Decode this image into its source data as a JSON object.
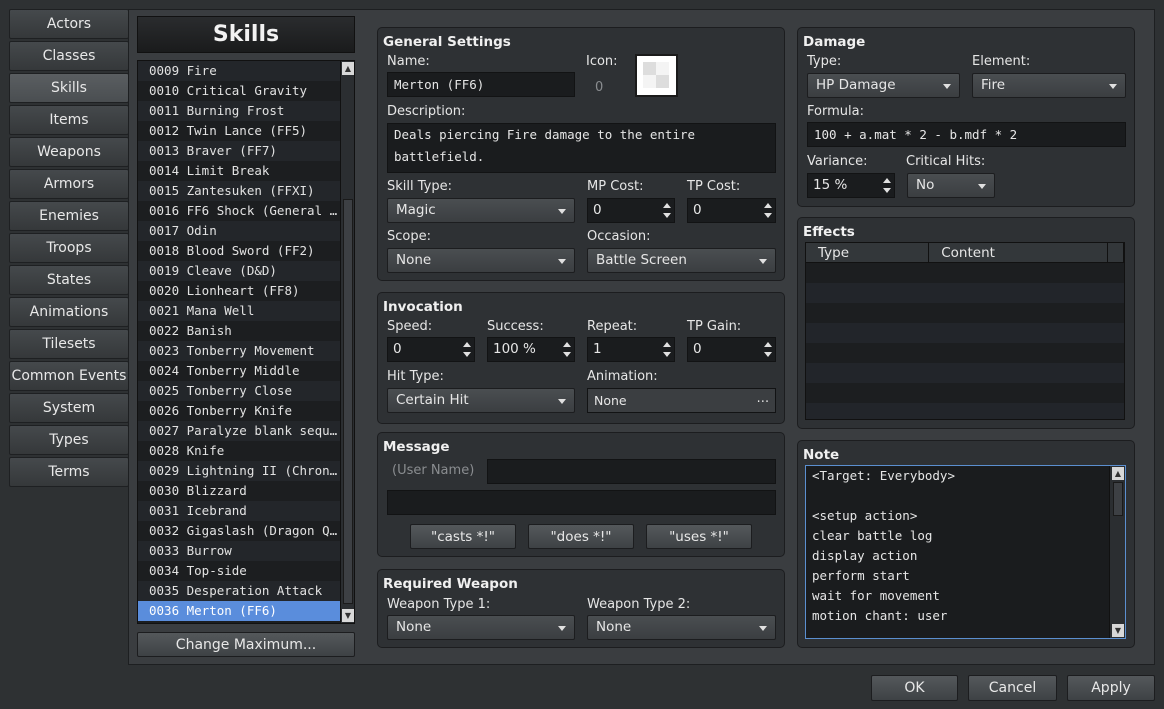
{
  "tabs": [
    "Actors",
    "Classes",
    "Skills",
    "Items",
    "Weapons",
    "Armors",
    "Enemies",
    "Troops",
    "States",
    "Animations",
    "Tilesets",
    "Common Events",
    "System",
    "Types",
    "Terms"
  ],
  "active_tab": "Skills",
  "list_title": "Skills",
  "skills": [
    "0009 Fire",
    "0010 Critical Gravity",
    "0011 Burning Frost",
    "0012 Twin Lance (FF5)",
    "0013 Braver (FF7)",
    "0014 Limit Break",
    "0015 Zantesuken (FFXI)",
    "0016 FF6 Shock (General L…",
    "0017 Odin",
    "0018 Blood Sword (FF2)",
    "0019 Cleave (D&D)",
    "0020 Lionheart (FF8)",
    "0021 Mana Well",
    "0022 Banish",
    "0023 Tonberry Movement",
    "0024 Tonberry Middle",
    "0025 Tonberry Close",
    "0026 Tonberry Knife",
    "0027 Paralyze blank seque…",
    "0028 Knife",
    "0029 Lightning II (Chrono…",
    "0030 Blizzard",
    "0031 Icebrand",
    "0032 Gigaslash (Dragon Qu…",
    "0033 Burrow",
    "0034 Top-side",
    "0035 Desperation Attack",
    "0036 Merton (FF6)"
  ],
  "selected_skill": "0036 Merton (FF6)",
  "change_maximum": "Change Maximum...",
  "general": {
    "title": "General Settings",
    "name_label": "Name:",
    "name_value": "Merton (FF6)",
    "icon_label": "Icon:",
    "icon_index": "0",
    "description_label": "Description:",
    "description_value": "Deals piercing Fire damage to the entire battlefield.",
    "skill_type_label": "Skill Type:",
    "skill_type_value": "Magic",
    "mp_label": "MP Cost:",
    "mp_value": "0",
    "tp_label": "TP Cost:",
    "tp_value": "0",
    "scope_label": "Scope:",
    "scope_value": "None",
    "occasion_label": "Occasion:",
    "occasion_value": "Battle Screen"
  },
  "invocation": {
    "title": "Invocation",
    "speed_label": "Speed:",
    "speed_value": "0",
    "success_label": "Success:",
    "success_value": "100 %",
    "repeat_label": "Repeat:",
    "repeat_value": "1",
    "tpgain_label": "TP Gain:",
    "tpgain_value": "0",
    "hit_label": "Hit Type:",
    "hit_value": "Certain Hit",
    "anim_label": "Animation:",
    "anim_value": "None",
    "anim_btn": "⋯"
  },
  "message": {
    "title": "Message",
    "user_name_placeholder": "(User Name)",
    "line1": "",
    "line2": "",
    "btn_casts": "\"casts *!\"",
    "btn_does": "\"does *!\"",
    "btn_uses": "\"uses *!\""
  },
  "weapon": {
    "title": "Required Weapon",
    "type1_label": "Weapon Type 1:",
    "type1_value": "None",
    "type2_label": "Weapon Type 2:",
    "type2_value": "None"
  },
  "damage": {
    "title": "Damage",
    "type_label": "Type:",
    "type_value": "HP Damage",
    "element_label": "Element:",
    "element_value": "Fire",
    "formula_label": "Formula:",
    "formula_value": "100 + a.mat * 2 - b.mdf * 2",
    "variance_label": "Variance:",
    "variance_value": "15 %",
    "crit_label": "Critical Hits:",
    "crit_value": "No"
  },
  "effects": {
    "title": "Effects",
    "col_type": "Type",
    "col_content": "Content"
  },
  "note": {
    "title": "Note",
    "lines": [
      "<Target: Everybody>",
      "",
      "<setup action>",
      "clear battle log",
      "display action",
      "perform start",
      "wait for movement",
      "motion chant: user"
    ]
  },
  "footer": {
    "ok": "OK",
    "cancel": "Cancel",
    "apply": "Apply"
  }
}
